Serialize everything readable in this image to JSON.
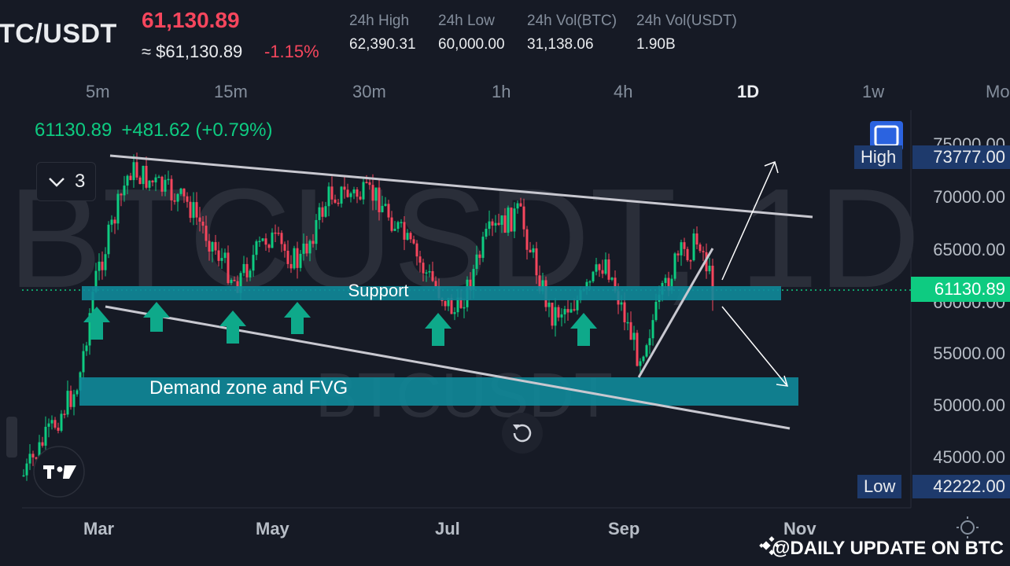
{
  "header": {
    "pair": "TC/USDT",
    "price": "61,130.89",
    "approx_price": "≈ $61,130.89",
    "change_pct": "-1.15%",
    "stats": [
      {
        "label": "24h High",
        "value": "62,390.31"
      },
      {
        "label": "24h Low",
        "value": "60,000.00"
      },
      {
        "label": "24h Vol(BTC)",
        "value": "31,138.06"
      },
      {
        "label": "24h Vol(USDT)",
        "value": "1.90B"
      }
    ]
  },
  "timeframes": [
    {
      "label": "5m",
      "active": false
    },
    {
      "label": "15m",
      "active": false
    },
    {
      "label": "30m",
      "active": false
    },
    {
      "label": "1h",
      "active": false
    },
    {
      "label": "4h",
      "active": false
    },
    {
      "label": "1D",
      "active": true
    },
    {
      "label": "1w",
      "active": false
    },
    {
      "label": "Mo",
      "active": false
    }
  ],
  "chart": {
    "ohlc_value": "61130.89",
    "ohlc_change": "+481.62 (+0.79%)",
    "indicator_count": "3",
    "bg_symbol": "BTCUSDT, 1D",
    "bg_symbol_small": "BTCUSDT",
    "y_ticks": [
      "75000.00",
      "70000.00",
      "65000.00",
      "60000.00",
      "55000.00",
      "50000.00",
      "45000.00"
    ],
    "high_label": "High",
    "high_value": "73777.00",
    "low_label": "Low",
    "low_value": "42222.00",
    "last_price": "61130.89",
    "x_ticks": [
      "Mar",
      "May",
      "Jul",
      "Sep",
      "Nov"
    ],
    "support_label": "Support",
    "demand_label": "Demand zone and FVG"
  },
  "watermark": "@DAILY UPDATE ON BTC",
  "colors": {
    "up": "#0ecb81",
    "down": "#f6465d",
    "zone": "#0f8a9a",
    "arrow": "#0ea98a"
  }
}
